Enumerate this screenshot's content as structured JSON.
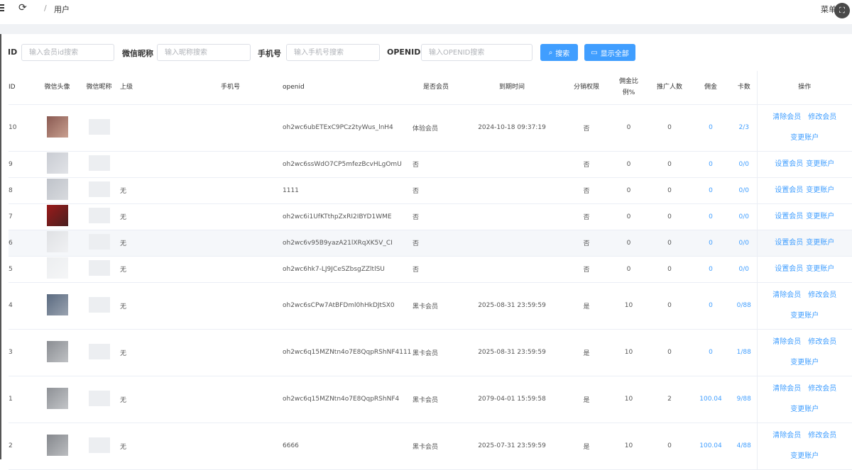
{
  "breadcrumb": {
    "separator": "/",
    "current": "用户"
  },
  "header": {
    "menu_text": "菜单"
  },
  "colors": {
    "accent": "#409eff"
  },
  "search": {
    "id_label": "ID",
    "id_placeholder": "输入会员id搜索",
    "nick_label": "微信昵称",
    "nick_placeholder": "输入昵称搜索",
    "phone_label": "手机号",
    "phone_placeholder": "输入手机号搜索",
    "openid_label": "OPENID",
    "openid_placeholder": "输入OPENID搜索",
    "search_button": "搜索",
    "show_all_button": "显示全部"
  },
  "table": {
    "headers": {
      "id": "ID",
      "avatar": "微信头像",
      "nickname": "微信昵称",
      "parent": "上级",
      "phone": "手机号",
      "openid": "openid",
      "is_member": "是否会员",
      "expire": "到期时间",
      "dist": "分销权限",
      "ratio_1": "佣金比",
      "ratio_2": "例%",
      "promo": "推广人数",
      "commission": "佣金",
      "cards": "卡数",
      "ops": "操作"
    },
    "rows": [
      {
        "id": "10",
        "parent": "",
        "openid": "oh2wc6ubETExC9PCz2tyWus_lnH4",
        "member": "体验会员",
        "expire": "2024-10-18 09:37:19",
        "dist": "否",
        "ratio": "0",
        "promo": "0",
        "commission": "0",
        "cards": "2/3",
        "ops": [
          "清除会员",
          "修改会员",
          "变更账户"
        ]
      },
      {
        "id": "9",
        "parent": "",
        "openid": "oh2wc6ssWdO7CP5mfezBcvHLgOmU",
        "member": "否",
        "expire": "",
        "dist": "否",
        "ratio": "0",
        "promo": "0",
        "commission": "0",
        "cards": "0/0",
        "ops": [
          "设置会员",
          "变更账户"
        ]
      },
      {
        "id": "8",
        "parent": "无",
        "openid": "1111",
        "member": "否",
        "expire": "",
        "dist": "否",
        "ratio": "0",
        "promo": "0",
        "commission": "0",
        "cards": "0/0",
        "ops": [
          "设置会员",
          "变更账户"
        ]
      },
      {
        "id": "7",
        "parent": "无",
        "openid": "oh2wc6i1UfKTthpZxRI2IBYD1WME",
        "member": "否",
        "expire": "",
        "dist": "否",
        "ratio": "0",
        "promo": "0",
        "commission": "0",
        "cards": "0/0",
        "ops": [
          "设置会员",
          "变更账户"
        ]
      },
      {
        "id": "6",
        "parent": "无",
        "openid": "oh2wc6v95B9yazA21lXRqXK5V_CI",
        "member": "否",
        "expire": "",
        "dist": "否",
        "ratio": "0",
        "promo": "0",
        "commission": "0",
        "cards": "0/0",
        "ops": [
          "设置会员",
          "变更账户"
        ]
      },
      {
        "id": "5",
        "parent": "无",
        "openid": "oh2wc6hk7-LJ9JCeSZbsgZZltlSU",
        "member": "否",
        "expire": "",
        "dist": "否",
        "ratio": "0",
        "promo": "0",
        "commission": "0",
        "cards": "0/0",
        "ops": [
          "设置会员",
          "变更账户"
        ]
      },
      {
        "id": "4",
        "parent": "无",
        "openid": "oh2wc6sCPw7AtBFDml0hHkDJtSX0",
        "member": "黑卡会员",
        "expire": "2025-08-31 23:59:59",
        "dist": "是",
        "ratio": "10",
        "promo": "0",
        "commission": "0",
        "cards": "0/88",
        "ops": [
          "清除会员",
          "修改会员",
          "变更账户"
        ]
      },
      {
        "id": "3",
        "parent": "无",
        "openid": "oh2wc6q15MZNtn4o7E8QqpRShNF4111",
        "member": "黑卡会员",
        "expire": "2025-08-31 23:59:59",
        "dist": "是",
        "ratio": "10",
        "promo": "0",
        "commission": "0",
        "cards": "1/88",
        "ops": [
          "清除会员",
          "修改会员",
          "变更账户"
        ]
      },
      {
        "id": "1",
        "parent": "无",
        "openid": "oh2wc6q15MZNtn4o7E8QqpRShNF4",
        "member": "黑卡会员",
        "expire": "2079-04-01 15:59:58",
        "dist": "是",
        "ratio": "10",
        "promo": "2",
        "commission": "100.04",
        "cards": "9/88",
        "ops": [
          "清除会员",
          "修改会员",
          "变更账户"
        ]
      },
      {
        "id": "2",
        "parent": "无",
        "openid": "6666",
        "member": "黑卡会员",
        "expire": "2025-07-31 23:59:59",
        "dist": "是",
        "ratio": "10",
        "promo": "0",
        "commission": "100.04",
        "cards": "4/88",
        "ops": [
          "清除会员",
          "修改会员",
          "变更账户"
        ]
      }
    ]
  }
}
